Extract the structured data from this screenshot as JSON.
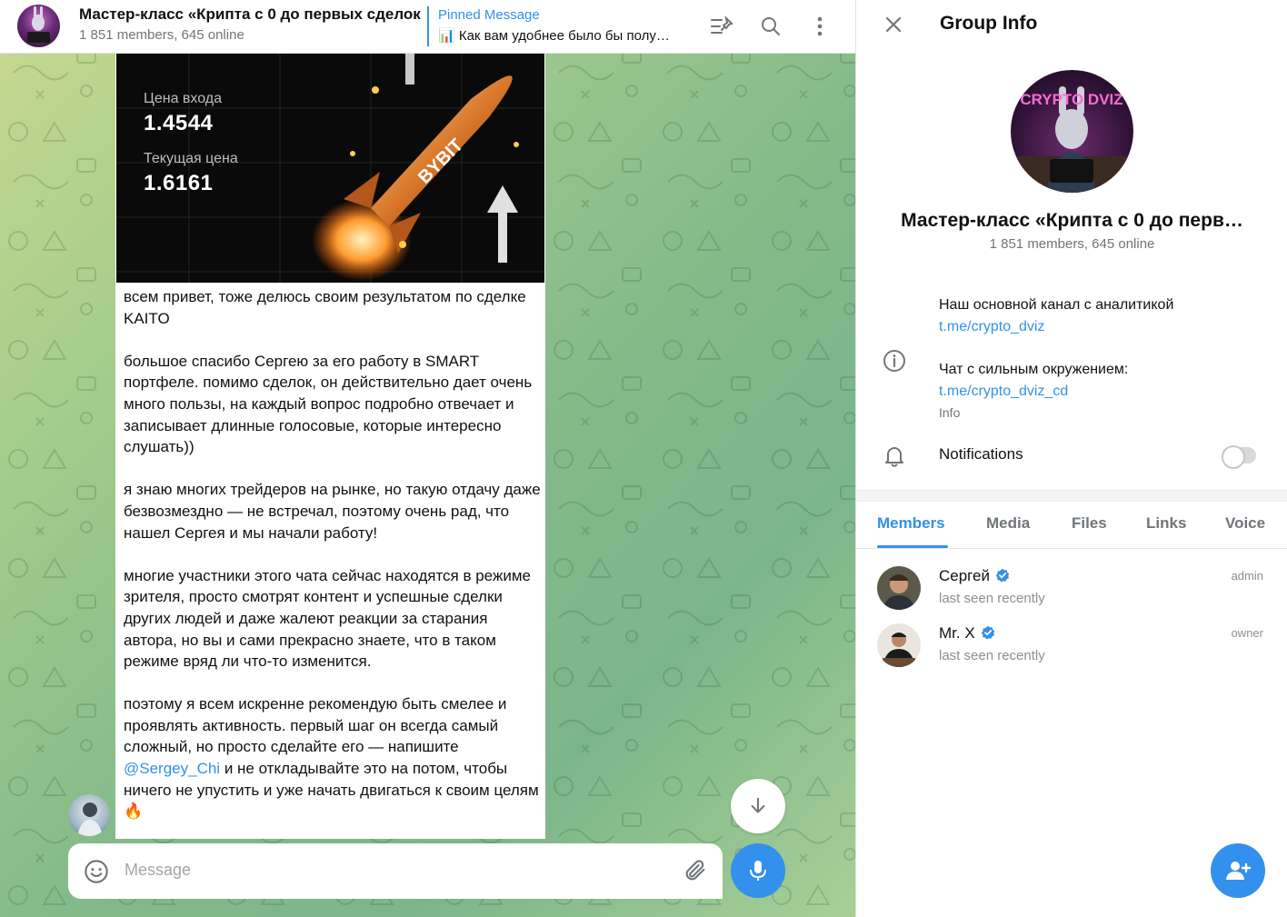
{
  "chat": {
    "title": "Мастер-класс «Крипта с 0 до первых сделок",
    "subtitle": "1 851 members, 645 online",
    "pinned_label": "Pinned Message",
    "pinned_text": "📊 Как вам удобнее было бы полу…",
    "icons": [
      "pin-list-icon",
      "search-icon",
      "more-icon"
    ]
  },
  "promo": {
    "entry_label": "Цена входа",
    "entry_value": "1.4544",
    "current_label": "Текущая цена",
    "current_value": "1.6161",
    "brand_text": "BYBIT"
  },
  "message": {
    "p1": "всем привет, тоже делюсь своим результатом по сделке KAITO",
    "p2": "большое спасибо Сергею за его работу в SMART портфеле. помимо сделок, он действительно дает очень много пользы, на каждый вопрос подробно отвечает и записывает длинные голосовые, которые интересно слушать))",
    "p3": "я знаю многих трейдеров на рынке, но такую отдачу даже безвозмездно — не встречал, поэтому очень рад, что нашел Сергея и мы начали работу!",
    "p4": "многие участники этого чата сейчас находятся в режиме зрителя, просто смотрят контент и успешные сделки других людей и даже жалеют реакции за старания автора, но вы и сами прекрасно знаете, что в таком режиме вряд ли что-то изменится.",
    "p5_before": "поэтому я всем искренне рекомендую быть смелее и проявлять активность. первый шаг он всегда самый сложный, но просто сделайте его — напишите ",
    "p5_mention": "@Sergey_Chi",
    "p5_after": " и не откладывайте это на потом, чтобы ничего не упустить и уже начать двигаться к своим целям🔥"
  },
  "composer": {
    "placeholder": "Message"
  },
  "info": {
    "title": "Group Info",
    "avatar_text": "CRYPTO DVIZ",
    "name": "Мастер-класс «Крипта с 0 до перв…",
    "members": "1 851 members, 645 online",
    "about_line1": "Наш основной канал с аналитикой",
    "about_link1": "t.me/crypto_dviz",
    "about_line2": "Чат с сильным окружением:",
    "about_link2": "t.me/crypto_dviz_cd",
    "about_label": "Info",
    "notifications_label": "Notifications",
    "notifications_on": false
  },
  "tabs": [
    "Members",
    "Media",
    "Files",
    "Links",
    "Voice"
  ],
  "members": [
    {
      "name": "Сергей",
      "status": "last seen recently",
      "role": "admin",
      "verified": true
    },
    {
      "name": "Mr. X",
      "status": "last seen recently",
      "role": "owner",
      "verified": true
    }
  ],
  "colors": {
    "accent": "#3390ec",
    "muted": "#707579"
  }
}
